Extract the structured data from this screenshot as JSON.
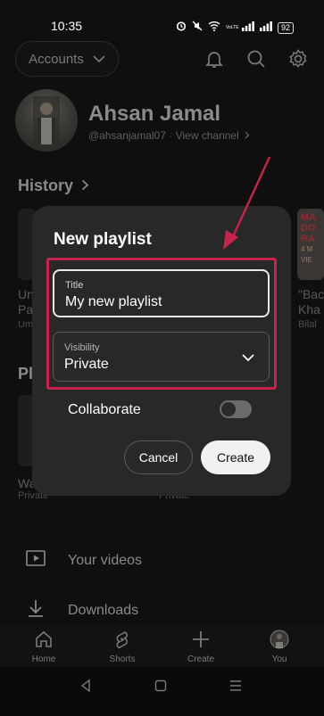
{
  "status_bar": {
    "time": "10:35",
    "battery": "92",
    "net_label": "VoLTE"
  },
  "header": {
    "accounts_label": "Accounts"
  },
  "channel": {
    "name": "Ahsan Jamal",
    "handle": "@ahsanjamal07",
    "view_channel": "View channel"
  },
  "history": {
    "title": "History",
    "left_snippet": [
      "Un",
      "Pa",
      "Um"
    ],
    "right_thumb_text": [
      "MA",
      "DO",
      "RA",
      "4 M",
      "VIE"
    ],
    "right_snippet": [
      "\"Bac",
      "Kha",
      "Bilal"
    ]
  },
  "playlists": {
    "title_snippet": "Pl",
    "left_item": {
      "name": "Wa",
      "privacy": "Private"
    },
    "right_item": {
      "privacy": "Private"
    }
  },
  "menu": [
    {
      "label": "Your videos",
      "icon": "play-box-icon"
    },
    {
      "label": "Downloads",
      "icon": "download-icon"
    }
  ],
  "dialog": {
    "title": "New playlist",
    "title_field": {
      "label": "Title",
      "value": "My new playlist"
    },
    "visibility_field": {
      "label": "Visibility",
      "value": "Private"
    },
    "collaborate_label": "Collaborate",
    "collaborate_on": false,
    "cancel_label": "Cancel",
    "create_label": "Create"
  },
  "bottom_nav": [
    {
      "label": "Home",
      "icon": "home-icon"
    },
    {
      "label": "Shorts",
      "icon": "shorts-icon"
    },
    {
      "label": "Create",
      "icon": "plus-icon"
    },
    {
      "label": "You",
      "icon": "avatar-icon"
    }
  ],
  "colors": {
    "highlight": "#c8234a",
    "background": "#0f0f0f",
    "dialog": "#282828"
  }
}
